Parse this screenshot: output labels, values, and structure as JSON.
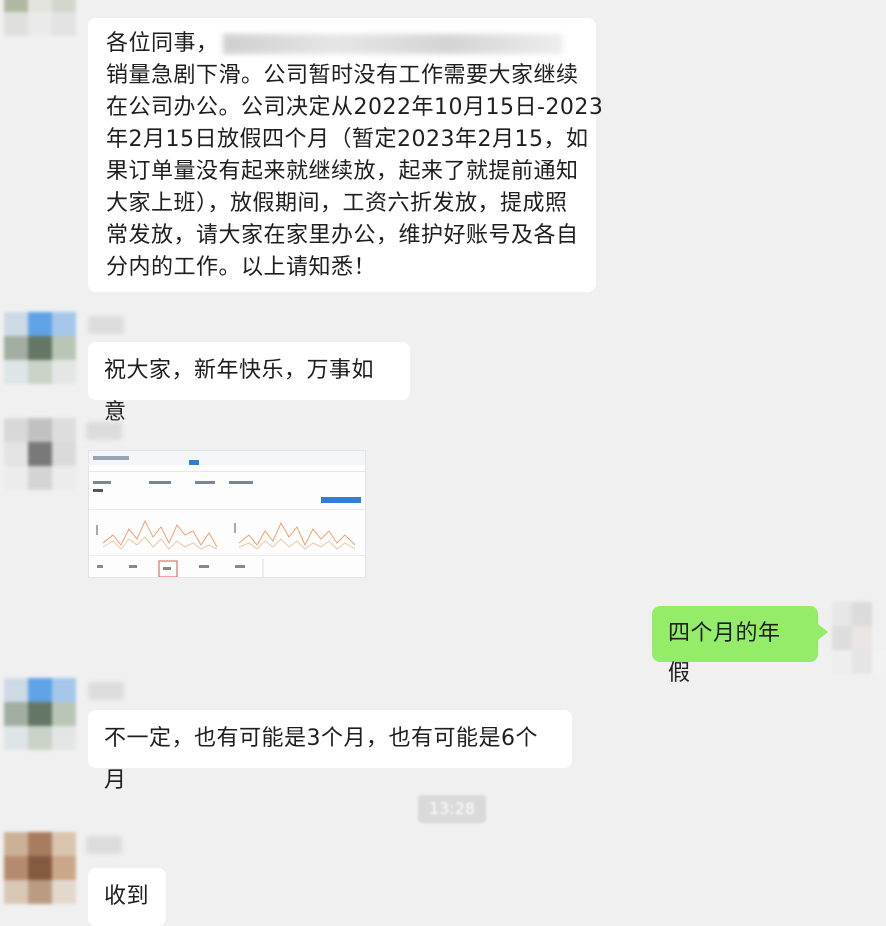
{
  "messages": [
    {
      "lines": [
        "各位同事，",
        "销量急剧下滑。公司暂时没有工作需要大家继续",
        "在公司办公。公司决定从2022年10月15日-2023",
        "年2月15日放假四个月（暂定2023年2月15，如",
        "果订单量没有起来就继续放，起来了就提前通知",
        "大家上班），放假期间，工资六折发放，提成照",
        "常发放，请大家在家里办公，维护好账号及各自",
        "分内的工作。以上请知悉！"
      ]
    },
    {
      "text": "祝大家，新年快乐，万事如意"
    },
    {
      "text": "四个月的年假"
    },
    {
      "text": "不一定，也有可能是3个月，也有可能是6个月"
    },
    {
      "text": "收到"
    }
  ],
  "timestamp": "13:28",
  "colors": {
    "background": "#f0f0f0",
    "incoming_bubble": "#ffffff",
    "outgoing_bubble": "#95ec69"
  }
}
